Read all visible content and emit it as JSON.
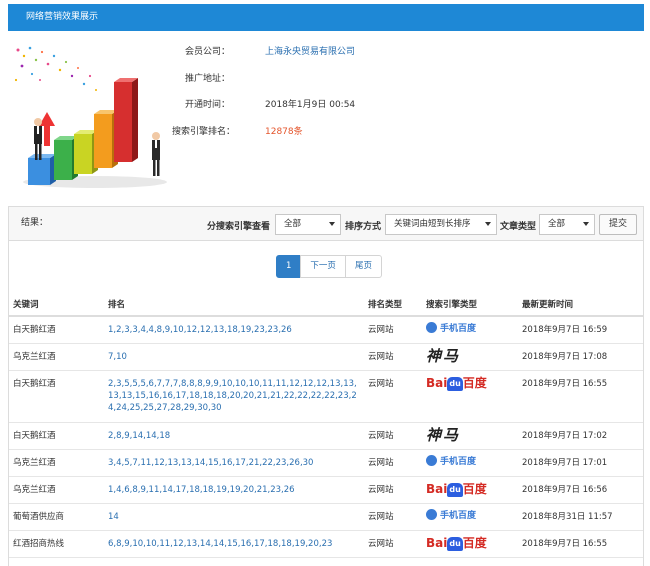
{
  "header": {
    "title": "网络营销效果展示"
  },
  "info": {
    "company_label": "会员公司：",
    "company_value": "上海永央贸易有限公司",
    "address_label": "推广地址：",
    "address_value": "",
    "open_time_label": "开通时间：",
    "open_time_value": "2018年1月9日 00:54",
    "rank_label": "搜索引擎排名：",
    "rank_value": "12878条"
  },
  "filters": {
    "result_label": "结果：",
    "engine_label": "分搜索引擎查看",
    "engine_value": "全部",
    "sort_label": "排序方式",
    "sort_value": "关键词由短到长排序",
    "type_label": "文章类型",
    "type_value": "全部",
    "submit_label": "提交"
  },
  "pagination": {
    "current": "1",
    "next": "下一页",
    "last": "尾页"
  },
  "table": {
    "headers": {
      "keyword": "关键词",
      "rank": "排名",
      "rank_type": "排名类型",
      "engine_type": "搜索引擎类型",
      "updated": "最新更新时间"
    },
    "rows": [
      {
        "keyword": "白天鹅红酒",
        "rank": "1,2,3,3,4,4,8,9,10,12,12,13,18,19,23,23,26",
        "rank_type": "云网站",
        "engine": "mobile-baidu",
        "updated": "2018年9月7日 16:59"
      },
      {
        "keyword": "乌克兰红酒",
        "rank": "7,10",
        "rank_type": "云网站",
        "engine": "shenma",
        "updated": "2018年9月7日 17:08"
      },
      {
        "keyword": "白天鹅红酒",
        "rank": "2,3,5,5,5,6,7,7,7,8,8,8,9,9,10,10,10,11,11,12,12,12,13,13,13,13,15,16,16,17,18,18,18,20,20,21,21,22,22,22,22,23,24,24,25,25,27,28,29,30,30",
        "rank_type": "云网站",
        "engine": "baidu",
        "updated": "2018年9月7日 16:55"
      },
      {
        "keyword": "白天鹅红酒",
        "rank": "2,8,9,14,14,18",
        "rank_type": "云网站",
        "engine": "shenma",
        "updated": "2018年9月7日 17:02"
      },
      {
        "keyword": "乌克兰红酒",
        "rank": "3,4,5,7,11,12,13,13,14,15,16,17,21,22,23,26,30",
        "rank_type": "云网站",
        "engine": "mobile-baidu",
        "updated": "2018年9月7日 17:01"
      },
      {
        "keyword": "乌克兰红酒",
        "rank": "1,4,6,8,9,11,14,17,18,18,19,19,20,21,23,26",
        "rank_type": "云网站",
        "engine": "baidu",
        "updated": "2018年9月7日 16:56"
      },
      {
        "keyword": "葡萄酒供应商",
        "rank": "14",
        "rank_type": "云网站",
        "engine": "mobile-baidu",
        "updated": "2018年8月31日 11:57"
      },
      {
        "keyword": "红酒招商热线",
        "rank": "6,8,9,10,10,11,12,13,14,14,15,16,17,18,18,19,20,23",
        "rank_type": "云网站",
        "engine": "baidu",
        "updated": "2018年9月7日 16:55"
      }
    ]
  },
  "logos": {
    "mobile_baidu_text": "手机百度",
    "shenma_text": "神马",
    "baidu_bai": "Bai",
    "baidu_du": "du",
    "baidu_cn": "百度"
  },
  "colors": {
    "header_bg": "#1e88d6",
    "link_blue": "#2a6fb0",
    "accent_orange": "#e4552c",
    "baidu_red": "#d42b24",
    "baidu_blue": "#2c5ee0"
  }
}
